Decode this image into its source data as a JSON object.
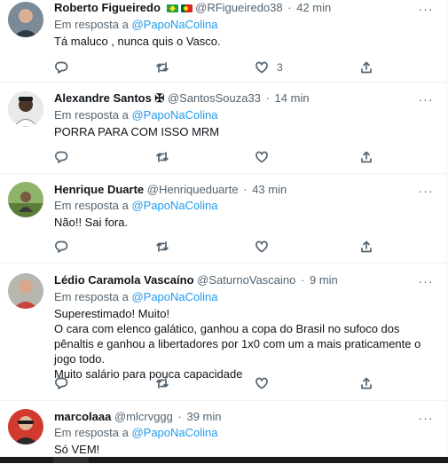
{
  "tweets": [
    {
      "name": "Roberto Figueiredo",
      "flags": [
        "brazil-flag",
        "portugal-flag"
      ],
      "handle": "@RFigueiredo38",
      "time": "42 min",
      "reply_prefix": "Em resposta a",
      "reply_to": "@PapoNaColina",
      "text": "Tá maluco , nunca quis o Vasco.",
      "likes": "3"
    },
    {
      "name": "Alexandre Santos ✠",
      "handle": "@SantosSouza33",
      "time": "14 min",
      "reply_prefix": "Em resposta a",
      "reply_to": "@PapoNaColina",
      "text": "PORRA PARA COM ISSO MRM",
      "likes": ""
    },
    {
      "name": "Henrique Duarte",
      "handle": "@Henriqueduarte",
      "time": "43 min",
      "reply_prefix": "Em resposta a",
      "reply_to": "@PapoNaColina",
      "text": "Não!! Sai fora.",
      "likes": ""
    },
    {
      "name": "Lédio Caramola Vascaíno",
      "handle": "@SaturnoVascaino",
      "time": "9 min",
      "reply_prefix": "Em resposta a",
      "reply_to": "@PapoNaColina",
      "text_lines": [
        "Superestimado! Muito!",
        "O cara com elenco galático, ganhou a copa do Brasil no sufoco dos pênaltis e ganhou a libertadores por 1x0 com um a mais praticamente o jogo todo.",
        "Muito salário para pouca capacidade"
      ],
      "likes": ""
    },
    {
      "name": "marcolaaa",
      "handle": "@mlcrvggg",
      "time": "39 min",
      "reply_prefix": "Em resposta a",
      "reply_to": "@PapoNaColina",
      "text": "Só VEM!"
    }
  ],
  "separator": "·",
  "more_icon": "more-horizontal-icon",
  "action_icons": [
    "reply-icon",
    "retweet-icon",
    "like-icon",
    "share-icon"
  ],
  "colors": {
    "link": "#1d9bf0",
    "secondary": "#536471",
    "text": "#0f1419",
    "border": "#eff3f4"
  }
}
